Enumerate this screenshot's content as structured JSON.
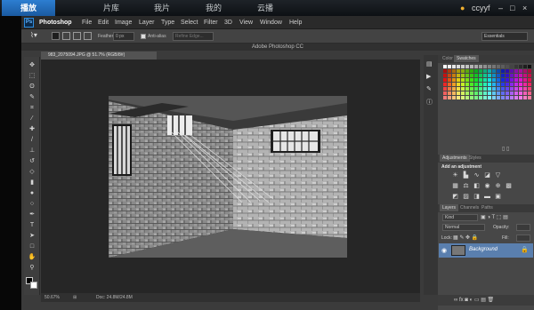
{
  "viewer": {
    "tabs": [
      "播放",
      "片库",
      "我片",
      "我的",
      "云播"
    ],
    "active_tab": "播放",
    "user": "ccyyf",
    "window_controls": [
      "minimize",
      "maximize",
      "close"
    ]
  },
  "app": {
    "logo": "Ps",
    "menus": [
      "Photoshop",
      "File",
      "Edit",
      "Image",
      "Layer",
      "Type",
      "Select",
      "Filter",
      "3D",
      "View",
      "Window",
      "Help"
    ],
    "title": "Adobe Photoshop CC",
    "options": {
      "feather_label": "Feather:",
      "feather_value": "0 px",
      "antialias_label": "Anti-alias",
      "refine_edge": "Refine Edge...",
      "workspace": "Essentials"
    },
    "document_tab": "983_2075094.JPG @ 51.7% (RGB/8#)",
    "status": {
      "zoom": "50.67%",
      "doc": "Doc: 24.8M/24.8M"
    },
    "accent": "#2d7ed1"
  },
  "tools": [
    "move",
    "marquee",
    "lasso",
    "quick-select",
    "crop",
    "eyedropper",
    "healing",
    "brush",
    "clone",
    "history-brush",
    "eraser",
    "gradient",
    "blur",
    "dodge",
    "pen",
    "type",
    "path-select",
    "shape",
    "hand",
    "zoom"
  ],
  "panels": {
    "color_tabs": [
      "Color",
      "Swatches"
    ],
    "adjustments_tabs": [
      "Adjustments",
      "Styles"
    ],
    "adjustments_heading": "Add an adjustment",
    "layers_tabs": [
      "Layers",
      "Channels",
      "Paths"
    ],
    "kind_filter": "Kind",
    "blend_mode": "Normal",
    "opacity_label": "Opacity:",
    "lock_label": "Lock:",
    "fill_label": "Fill:",
    "layer_name": "Background"
  }
}
